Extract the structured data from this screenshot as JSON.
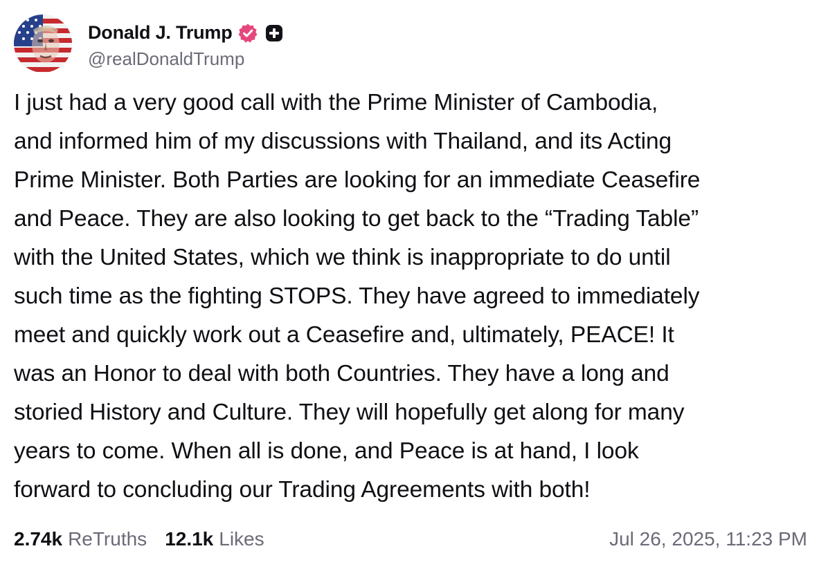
{
  "author": {
    "display_name": "Donald J. Trump",
    "handle": "@realDonaldTrump",
    "avatar_icon": "avatar-flag-portrait",
    "verified_icon": "verified-badge-icon",
    "verified_color": "#e5487c",
    "plus_icon": "plus-badge-icon"
  },
  "post": {
    "text": "I just had a very good call with the Prime Minister of Cambodia,\nand informed him of my discussions with Thailand, and its Acting\nPrime Minister. Both Parties are looking for an immediate Ceasefire\nand Peace. They are also looking to get back to the “Trading Table”\nwith the United States, which we think is inappropriate to do until\nsuch time as the fighting STOPS. They have agreed to immediately\nmeet and quickly work out a Ceasefire and, ultimately, PEACE! It\nwas an Honor to deal with both Countries. They have a long and\nstoried History and Culture. They will hopefully get along for many\nyears to come. When all is done, and Peace is at hand, I look\nforward to concluding our Trading Agreements with both!"
  },
  "stats": {
    "retruths_count": "2.74k",
    "retruths_label": "ReTruths",
    "likes_count": "12.1k",
    "likes_label": "Likes"
  },
  "timestamp": "Jul 26, 2025, 11:23 PM",
  "colors": {
    "text": "#0f0f14",
    "muted": "#6b6b78",
    "background": "#ffffff"
  }
}
